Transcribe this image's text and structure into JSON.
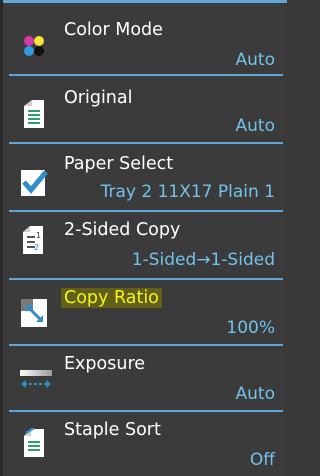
{
  "menu": {
    "items": [
      {
        "label": "Color Mode",
        "value": "Auto",
        "icon": "color-mode-icon"
      },
      {
        "label": "Original",
        "value": "Auto",
        "icon": "original-document-icon"
      },
      {
        "label": "Paper Select",
        "value": "Tray 2 11X17 Plain 1",
        "icon": "paper-select-check-icon"
      },
      {
        "label": "2-Sided Copy",
        "value": "1-Sided→1-Sided",
        "icon": "two-sided-copy-icon"
      },
      {
        "label": "Copy Ratio",
        "value": "100%",
        "icon": "copy-ratio-icon"
      },
      {
        "label": "Exposure",
        "value": "Auto",
        "icon": "exposure-icon"
      },
      {
        "label": "Staple Sort",
        "value": "Off",
        "icon": "staple-sort-icon"
      }
    ]
  },
  "colors": {
    "accent": "#5ea7d6",
    "value_text": "#73c2ec",
    "highlight_text": "#f3f324",
    "background": "#3b3b3b"
  }
}
